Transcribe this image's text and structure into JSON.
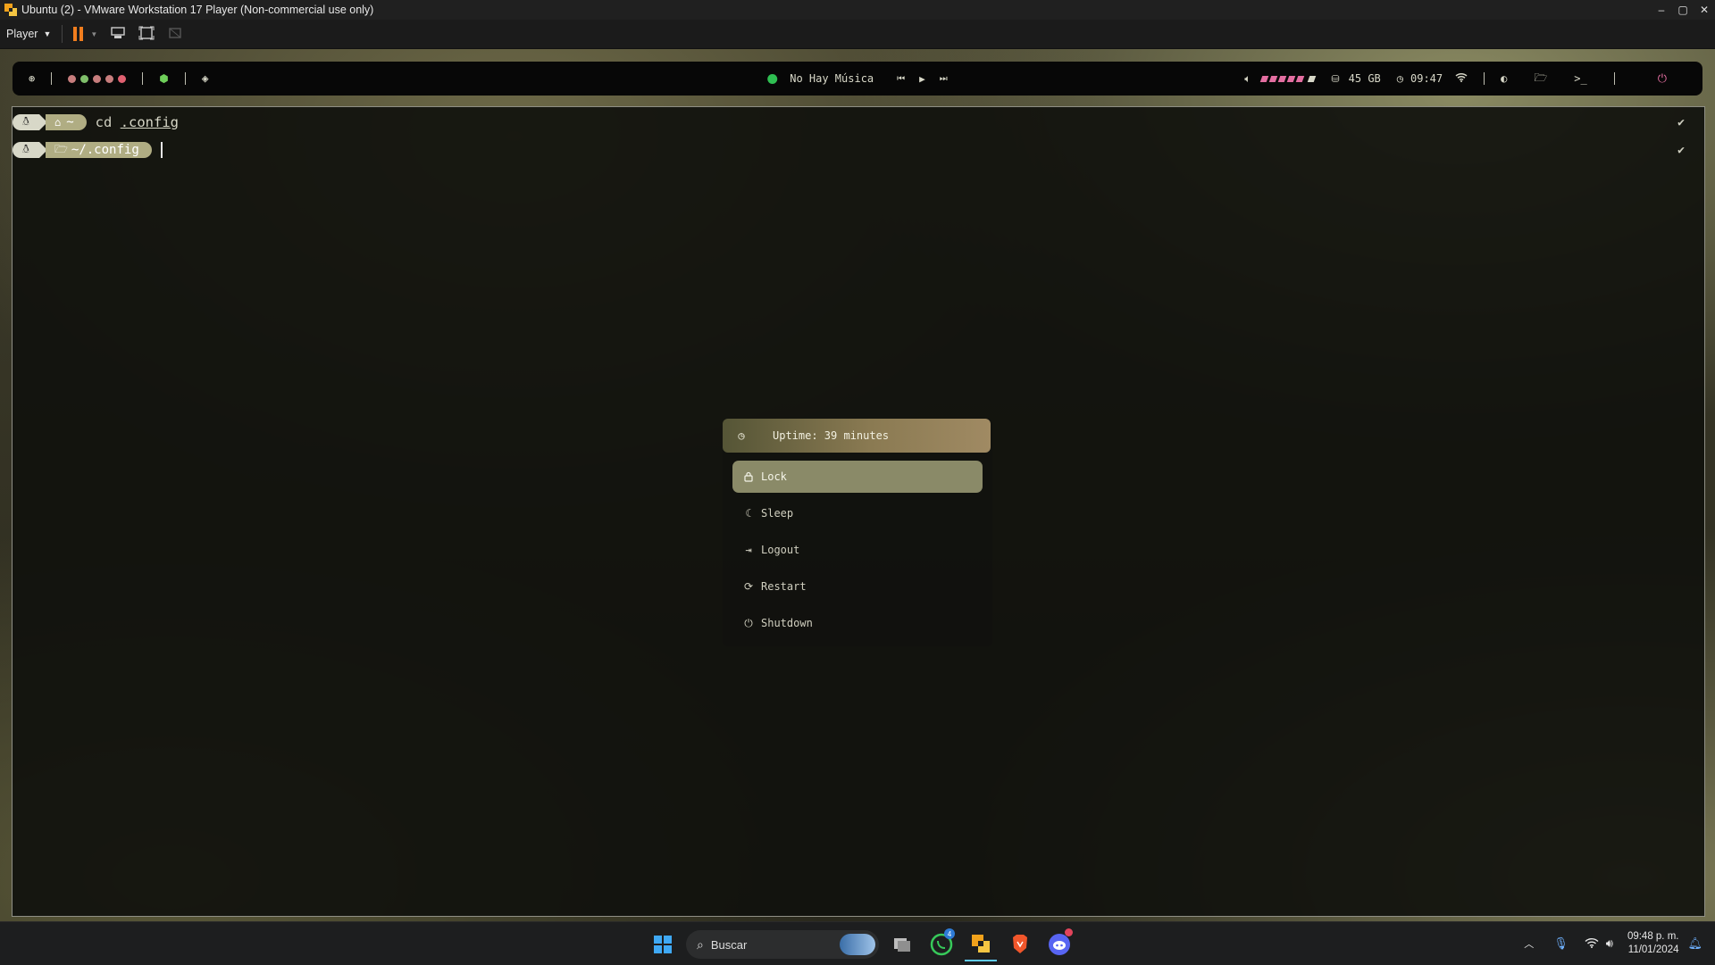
{
  "window": {
    "title": "Ubuntu (2) - VMware Workstation 17 Player (Non-commercial use only)",
    "controls": {
      "minimize": "–",
      "maximize": "▢",
      "close": "✕"
    }
  },
  "vm_toolbar": {
    "player_label": "Player"
  },
  "topbar": {
    "music_status": "No Hay Música",
    "disk": "45 GB",
    "time": "09:47",
    "terminal_glyph": ">_",
    "volume_level_bars": 7,
    "volume_total_bars": 7,
    "workspace_colors": [
      "#c77d7d",
      "#7fbf6a",
      "#c77d7d",
      "#c77d7d",
      "#e06070"
    ],
    "accent": "#e46ea1"
  },
  "terminal": {
    "lines": [
      {
        "path": "~",
        "command": "cd",
        "arg": ".config",
        "status": "✔"
      },
      {
        "path": "~/.config",
        "command": "",
        "arg": "",
        "status": "✔"
      }
    ]
  },
  "power_menu": {
    "uptime": "Uptime: 39 minutes",
    "items": [
      {
        "label": "Lock",
        "icon": "lock-icon",
        "active": true
      },
      {
        "label": "Sleep",
        "icon": "moon-icon",
        "active": false
      },
      {
        "label": "Logout",
        "icon": "logout-icon",
        "active": false
      },
      {
        "label": "Restart",
        "icon": "restart-icon",
        "active": false
      },
      {
        "label": "Shutdown",
        "icon": "power-icon",
        "active": false
      }
    ]
  },
  "taskbar": {
    "search_placeholder": "Buscar",
    "whatsapp_badge": "4",
    "clock_time": "09:48 p. m.",
    "clock_date": "11/01/2024"
  }
}
